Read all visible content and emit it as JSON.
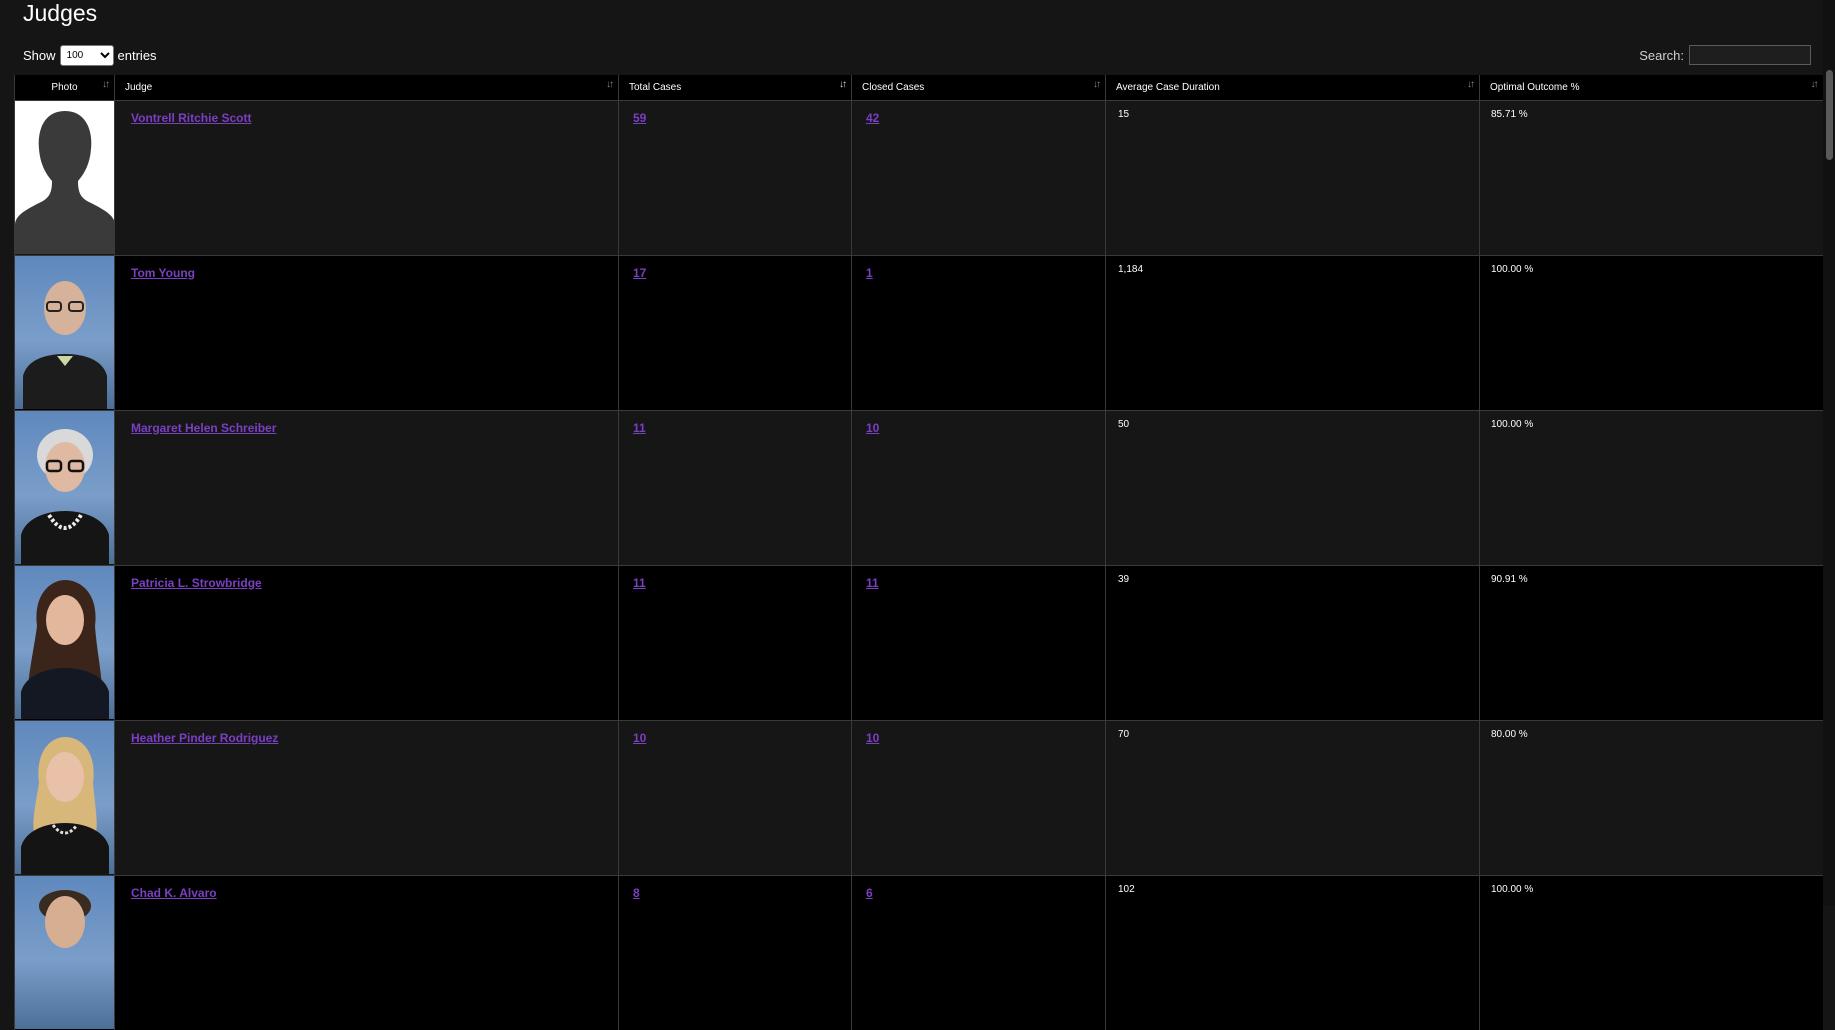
{
  "page": {
    "title": "Judges"
  },
  "controls": {
    "show_label": "Show",
    "entries_value": "100",
    "entries_label": "entries",
    "search_label": "Search:",
    "search_value": ""
  },
  "table": {
    "headers": {
      "photo": "Photo",
      "judge": "Judge",
      "total_cases": "Total Cases",
      "closed_cases": "Closed Cases",
      "avg_duration": "Average Case Duration",
      "optimal_outcome": "Optimal Outcome %"
    },
    "rows": [
      {
        "name": "Vontrell Ritchie Scott",
        "total": "59",
        "closed": "42",
        "duration": "15",
        "outcome": "85.71 %",
        "photo": "silhouette"
      },
      {
        "name": "Tom Young",
        "total": "17",
        "closed": "1",
        "duration": "1,184",
        "outcome": "100.00 %",
        "photo": "portrait"
      },
      {
        "name": "Margaret Helen Schreiber",
        "total": "11",
        "closed": "10",
        "duration": "50",
        "outcome": "100.00 %",
        "photo": "portrait"
      },
      {
        "name": "Patricia L. Strowbridge",
        "total": "11",
        "closed": "11",
        "duration": "39",
        "outcome": "90.91 %",
        "photo": "portrait"
      },
      {
        "name": "Heather Pinder Rodriguez",
        "total": "10",
        "closed": "10",
        "duration": "70",
        "outcome": "80.00 %",
        "photo": "portrait"
      },
      {
        "name": "Chad K. Alvaro",
        "total": "8",
        "closed": "6",
        "duration": "102",
        "outcome": "100.00 %",
        "photo": "portrait"
      }
    ]
  },
  "colors": {
    "link": "#7a3fc2",
    "background": "#151515",
    "header": "#000000"
  }
}
